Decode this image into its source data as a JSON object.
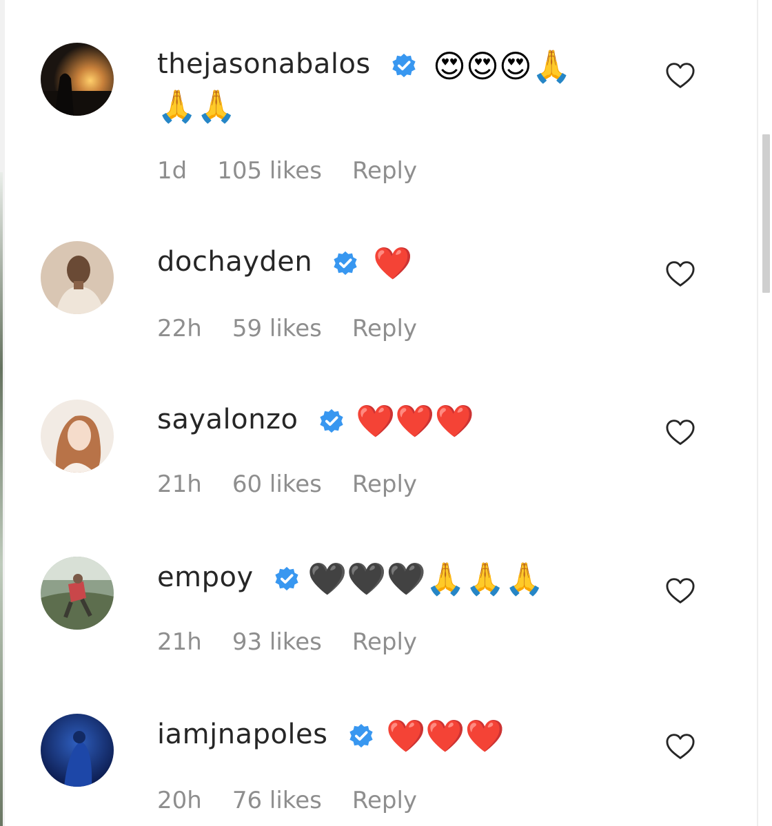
{
  "comments": [
    {
      "username": "thejasonabalos",
      "emojis_line1": "😍😍😍🙏",
      "emojis_line2": "🙏🙏",
      "time": "1d",
      "likes": "105 likes",
      "reply": "Reply"
    },
    {
      "username": "dochayden",
      "emojis_line1": "❤️",
      "time": "22h",
      "likes": "59 likes",
      "reply": "Reply"
    },
    {
      "username": "sayalonzo",
      "emojis_line1": "❤️❤️❤️",
      "time": "21h",
      "likes": "60 likes",
      "reply": "Reply"
    },
    {
      "username": "empoy",
      "emojis_line1": "🖤🖤🖤🙏🙏🙏",
      "time": "21h",
      "likes": "93 likes",
      "reply": "Reply"
    },
    {
      "username": "iamjnapoles",
      "emojis_line1": "❤️❤️❤️",
      "time": "20h",
      "likes": "76 likes",
      "reply": "Reply"
    }
  ],
  "colors": {
    "username": "#262626",
    "meta": "#8e8e8e",
    "verified": "#3897f0",
    "heart_outline": "#262626"
  },
  "icons": {
    "verified": "verified-badge-icon",
    "like": "heart-outline-icon"
  }
}
